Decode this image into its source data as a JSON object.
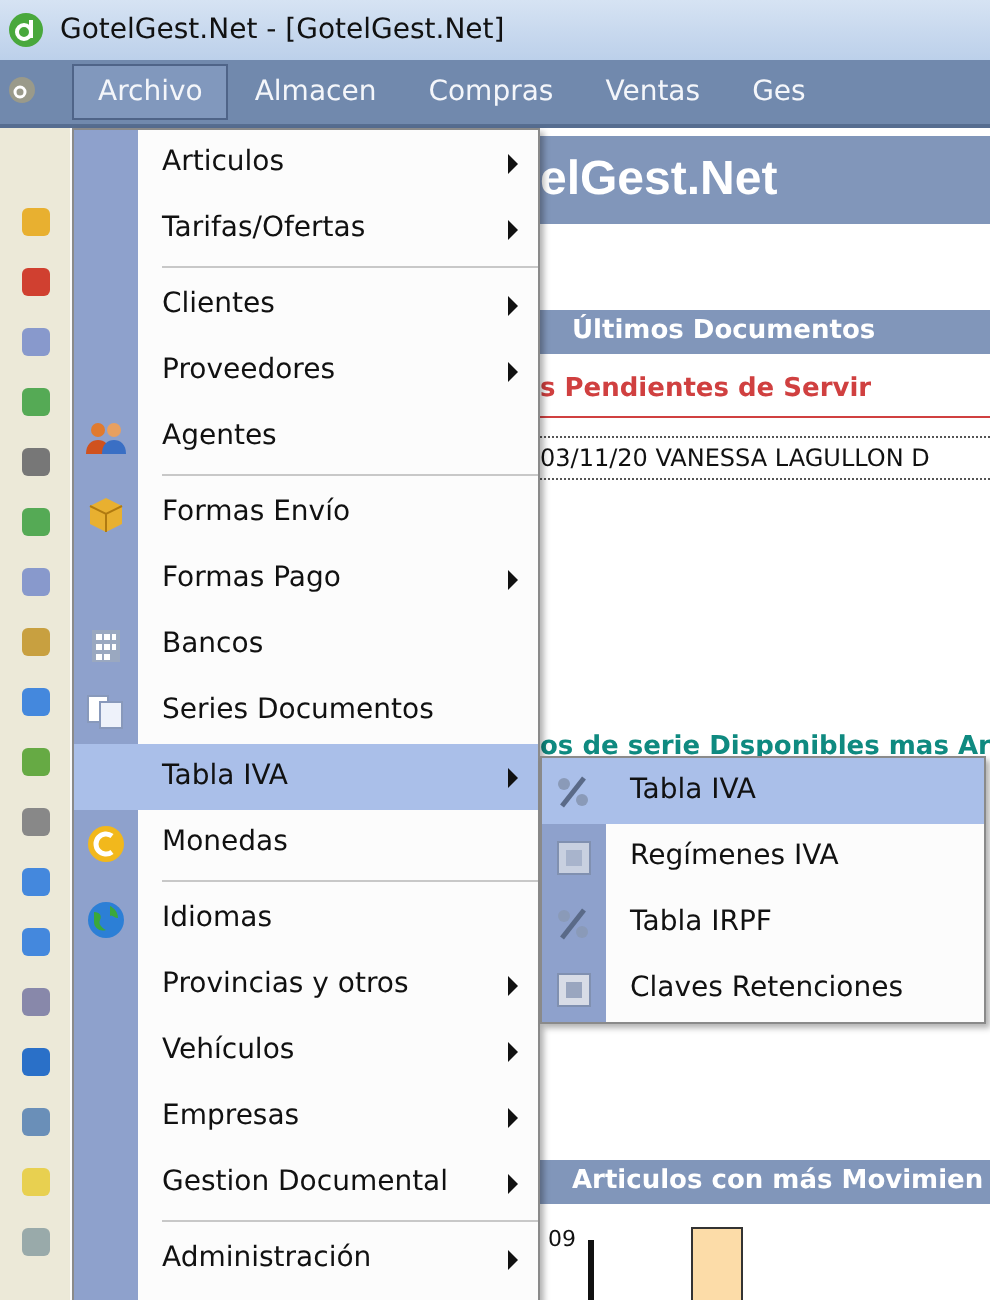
{
  "window": {
    "title": "GotelGest.Net - [GotelGest.Net]"
  },
  "menubar": [
    {
      "label": "Archivo",
      "selected": true
    },
    {
      "label": "Almacen",
      "selected": false
    },
    {
      "label": "Compras",
      "selected": false
    },
    {
      "label": "Ventas",
      "selected": false
    },
    {
      "label": "Ges",
      "selected": false
    }
  ],
  "background": {
    "header_title": "elGest.Net",
    "section_documents": "Últimos Documentos",
    "pending_title": "s Pendientes de Servir",
    "document_row": "03/11/20  VANESSA LAGULLON D",
    "series_title": "os de serie Disponibles mas Ar",
    "section_articles": "Articulos con más Movimien",
    "chart_label": "09"
  },
  "menu": [
    {
      "label": "Articulos",
      "kind": "plain",
      "submenu": true,
      "separator_before": false,
      "selected": false
    },
    {
      "label": "Tarifas/Ofertas",
      "kind": "plain",
      "submenu": true,
      "separator_before": false,
      "selected": false
    },
    {
      "label": "Clientes",
      "kind": "plain",
      "submenu": true,
      "separator_before": true,
      "selected": false
    },
    {
      "label": "Proveedores",
      "kind": "plain",
      "submenu": true,
      "separator_before": false,
      "selected": false
    },
    {
      "label": "Agentes",
      "kind": "people",
      "submenu": false,
      "separator_before": false,
      "selected": false
    },
    {
      "label": "Formas Envío",
      "kind": "box",
      "submenu": false,
      "separator_before": true,
      "selected": false
    },
    {
      "label": "Formas Pago",
      "kind": "plain",
      "submenu": true,
      "separator_before": false,
      "selected": false
    },
    {
      "label": "Bancos",
      "kind": "building",
      "submenu": false,
      "separator_before": false,
      "selected": false
    },
    {
      "label": "Series Documentos",
      "kind": "pages",
      "submenu": false,
      "separator_before": false,
      "selected": false
    },
    {
      "label": "Tabla IVA",
      "kind": "plain",
      "submenu": true,
      "separator_before": false,
      "selected": true
    },
    {
      "label": "Monedas",
      "kind": "coin",
      "submenu": false,
      "separator_before": false,
      "selected": false
    },
    {
      "label": "Idiomas",
      "kind": "globe",
      "submenu": false,
      "separator_before": true,
      "selected": false
    },
    {
      "label": "Provincias y otros",
      "kind": "plain",
      "submenu": true,
      "separator_before": false,
      "selected": false
    },
    {
      "label": "Vehículos",
      "kind": "plain",
      "submenu": true,
      "separator_before": false,
      "selected": false
    },
    {
      "label": "Empresas",
      "kind": "plain",
      "submenu": true,
      "separator_before": false,
      "selected": false
    },
    {
      "label": "Gestion Documental",
      "kind": "plain",
      "submenu": true,
      "separator_before": false,
      "selected": false
    },
    {
      "label": "Administración",
      "kind": "plain",
      "submenu": true,
      "separator_before": true,
      "selected": false
    }
  ],
  "submenu": [
    {
      "label": "Tabla IVA",
      "kind": "percent",
      "selected": true
    },
    {
      "label": "Regímenes IVA",
      "kind": "form",
      "selected": false
    },
    {
      "label": "Tabla IRPF",
      "kind": "percent",
      "selected": false
    },
    {
      "label": "Claves Retenciones",
      "kind": "r-key",
      "selected": false
    }
  ]
}
